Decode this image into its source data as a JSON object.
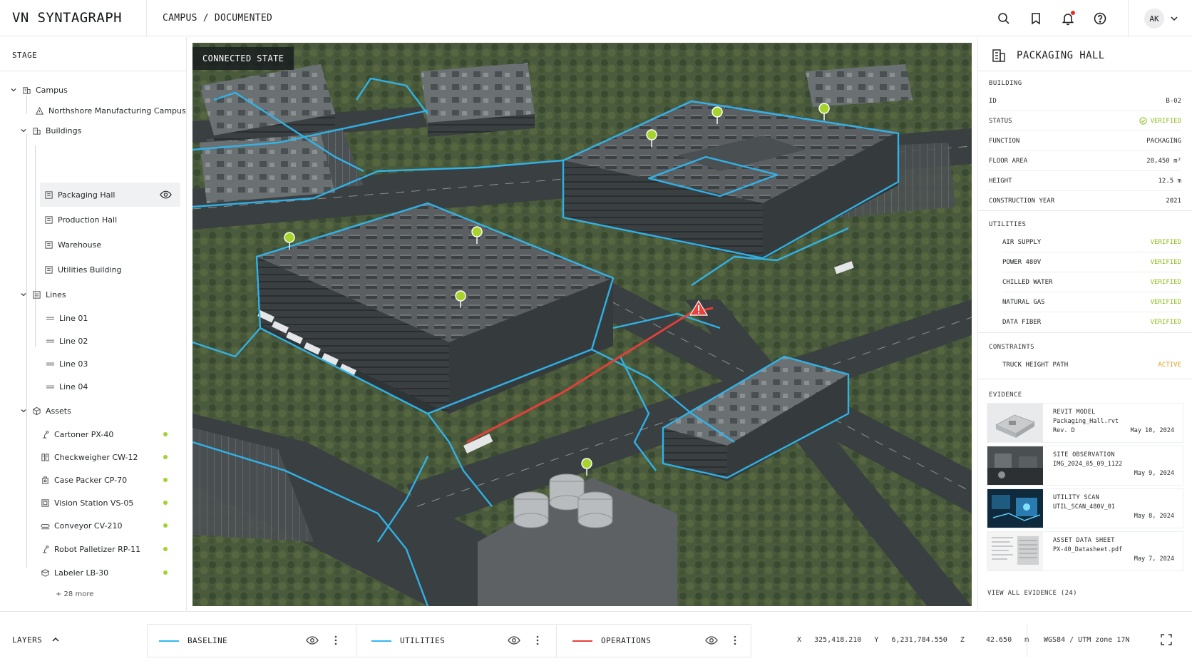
{
  "app": {
    "title": "VN SYNTAGRAPH"
  },
  "breadcrumb": {
    "items": [
      "CAMPUS",
      "/",
      "DOCUMENTED"
    ]
  },
  "header": {
    "icons": [
      "search-icon",
      "bookmark-icon",
      "bell-icon",
      "help-icon"
    ],
    "user_initials": "AK",
    "has_notification": true
  },
  "sidebar": {
    "title": "STAGE",
    "tree": {
      "campus": "Campus",
      "site": "Northshore Manufacturing Campus",
      "buildings": "Buildings",
      "building_items": [
        "Packaging Hall",
        "Production Hall",
        "Warehouse",
        "Utilities Building"
      ],
      "selected": "Packaging Hall",
      "lines": "Lines",
      "line_items": [
        "Line 01",
        "Line 02",
        "Line 03",
        "Line 04"
      ],
      "assets": "Assets",
      "asset_items": [
        "Cartoner PX-40",
        "Checkweigher CW-12",
        "Case Packer CP-70",
        "Vision Station VS-05",
        "Conveyor CV-210",
        "Robot Palletizer RP-11",
        "Labeler LB-30"
      ],
      "asset_status_color": "#9ed42b",
      "more": "+ 28 more"
    }
  },
  "map": {
    "label": "CONNECTED STATE",
    "colors": {
      "utilities": "#2fb8f0",
      "operations": "#e8403a",
      "verified_pin": "#a6d42c",
      "warning": "#e8403a"
    }
  },
  "details": {
    "title": "PACKAGING HALL",
    "building_section": "BUILDING",
    "fields": [
      {
        "key": "ID",
        "value": "B-02"
      },
      {
        "key": "STATUS",
        "value": "VERIFIED"
      },
      {
        "key": "FUNCTION",
        "value": "PACKAGING"
      },
      {
        "key": "FLOOR AREA",
        "value": "28,450 m²"
      },
      {
        "key": "HEIGHT",
        "value": "12.5 m"
      },
      {
        "key": "CONSTRUCTION YEAR",
        "value": "2021"
      }
    ],
    "utilities_section": "UTILITIES",
    "utilities": [
      {
        "name": "AIR SUPPLY",
        "status": "VERIFIED"
      },
      {
        "name": "POWER 480V",
        "status": "VERIFIED"
      },
      {
        "name": "CHILLED WATER",
        "status": "VERIFIED"
      },
      {
        "name": "NATURAL GAS",
        "status": "VERIFIED"
      },
      {
        "name": "DATA FIBER",
        "status": "VERIFIED"
      }
    ],
    "constraints_section": "CONSTRAINTS",
    "constraints": [
      {
        "name": "TRUCK HEIGHT PATH",
        "status": "ACTIVE"
      }
    ],
    "evidence_section": "EVIDENCE",
    "evidence": [
      {
        "title": "REVIT MODEL",
        "file": "Packaging_Hall.rvt",
        "rev": "Rev. D",
        "date": "May 10, 2024"
      },
      {
        "title": "SITE OBSERVATION",
        "file": "IMG_2024_05_09_1122",
        "rev": "",
        "date": "May 9, 2024"
      },
      {
        "title": "UTILITY SCAN",
        "file": "UTIL_SCAN_480V_01",
        "rev": "",
        "date": "May 8, 2024"
      },
      {
        "title": "ASSET DATA SHEET",
        "file": "PX-40_Datasheet.pdf",
        "rev": "",
        "date": "May 7, 2024"
      }
    ],
    "view_all": "VIEW ALL EVIDENCE (24)"
  },
  "layers": {
    "title": "LAYERS",
    "items": [
      {
        "name": "BASELINE",
        "color": "#2fb8f0"
      },
      {
        "name": "UTILITIES",
        "color": "#2fb8f0"
      },
      {
        "name": "OPERATIONS",
        "color": "#e8403a"
      }
    ]
  },
  "coordinates": {
    "x_label": "X",
    "x": "325,418.210",
    "y_label": "Y",
    "y": "6,231,784.550",
    "z_label": "Z",
    "z": "42.650",
    "unit": "m",
    "crs": "WGS84 / UTM zone 17N"
  }
}
